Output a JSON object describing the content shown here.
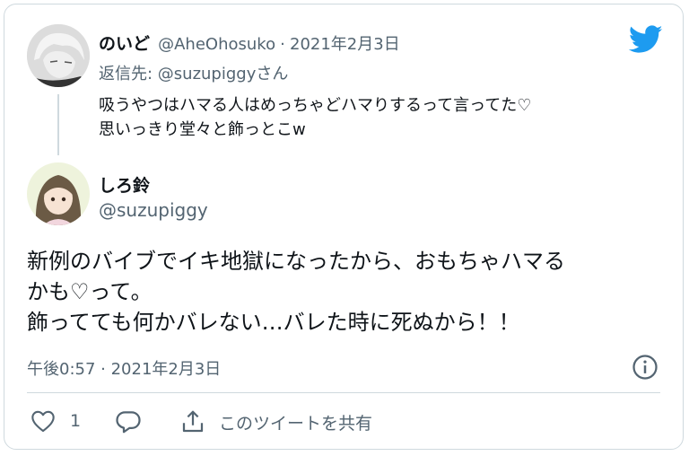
{
  "reply": {
    "display_name": "のいど",
    "handle": "@AheOhosuko",
    "separator": "·",
    "date": "2021年2月3日",
    "replying_to": "返信先: @suzupiggyさん",
    "lines": [
      "吸うやつはハマる人はめっちゃどハマりするって言ってた♡",
      "思いっきり堂々と飾っとこw"
    ]
  },
  "tweet": {
    "display_name": "しろ鈴",
    "handle": "@suzupiggy",
    "lines": [
      "新例のバイブでイキ地獄になったから、おもちゃハマる",
      "かも♡って。",
      "飾ってても何かバレない…バレた時に死ぬから！！"
    ],
    "timestamp": "午後0:57 · 2021年2月3日"
  },
  "actions": {
    "like_count": "1",
    "share_label": "このツイートを共有"
  },
  "colors": {
    "brand": "#1d9bf0",
    "text": "#0f1419",
    "secondary": "#536471",
    "border": "#cfd9de"
  },
  "icons": [
    "twitter-bird-icon",
    "info-icon",
    "heart-icon",
    "reply-bubble-icon",
    "share-icon"
  ]
}
